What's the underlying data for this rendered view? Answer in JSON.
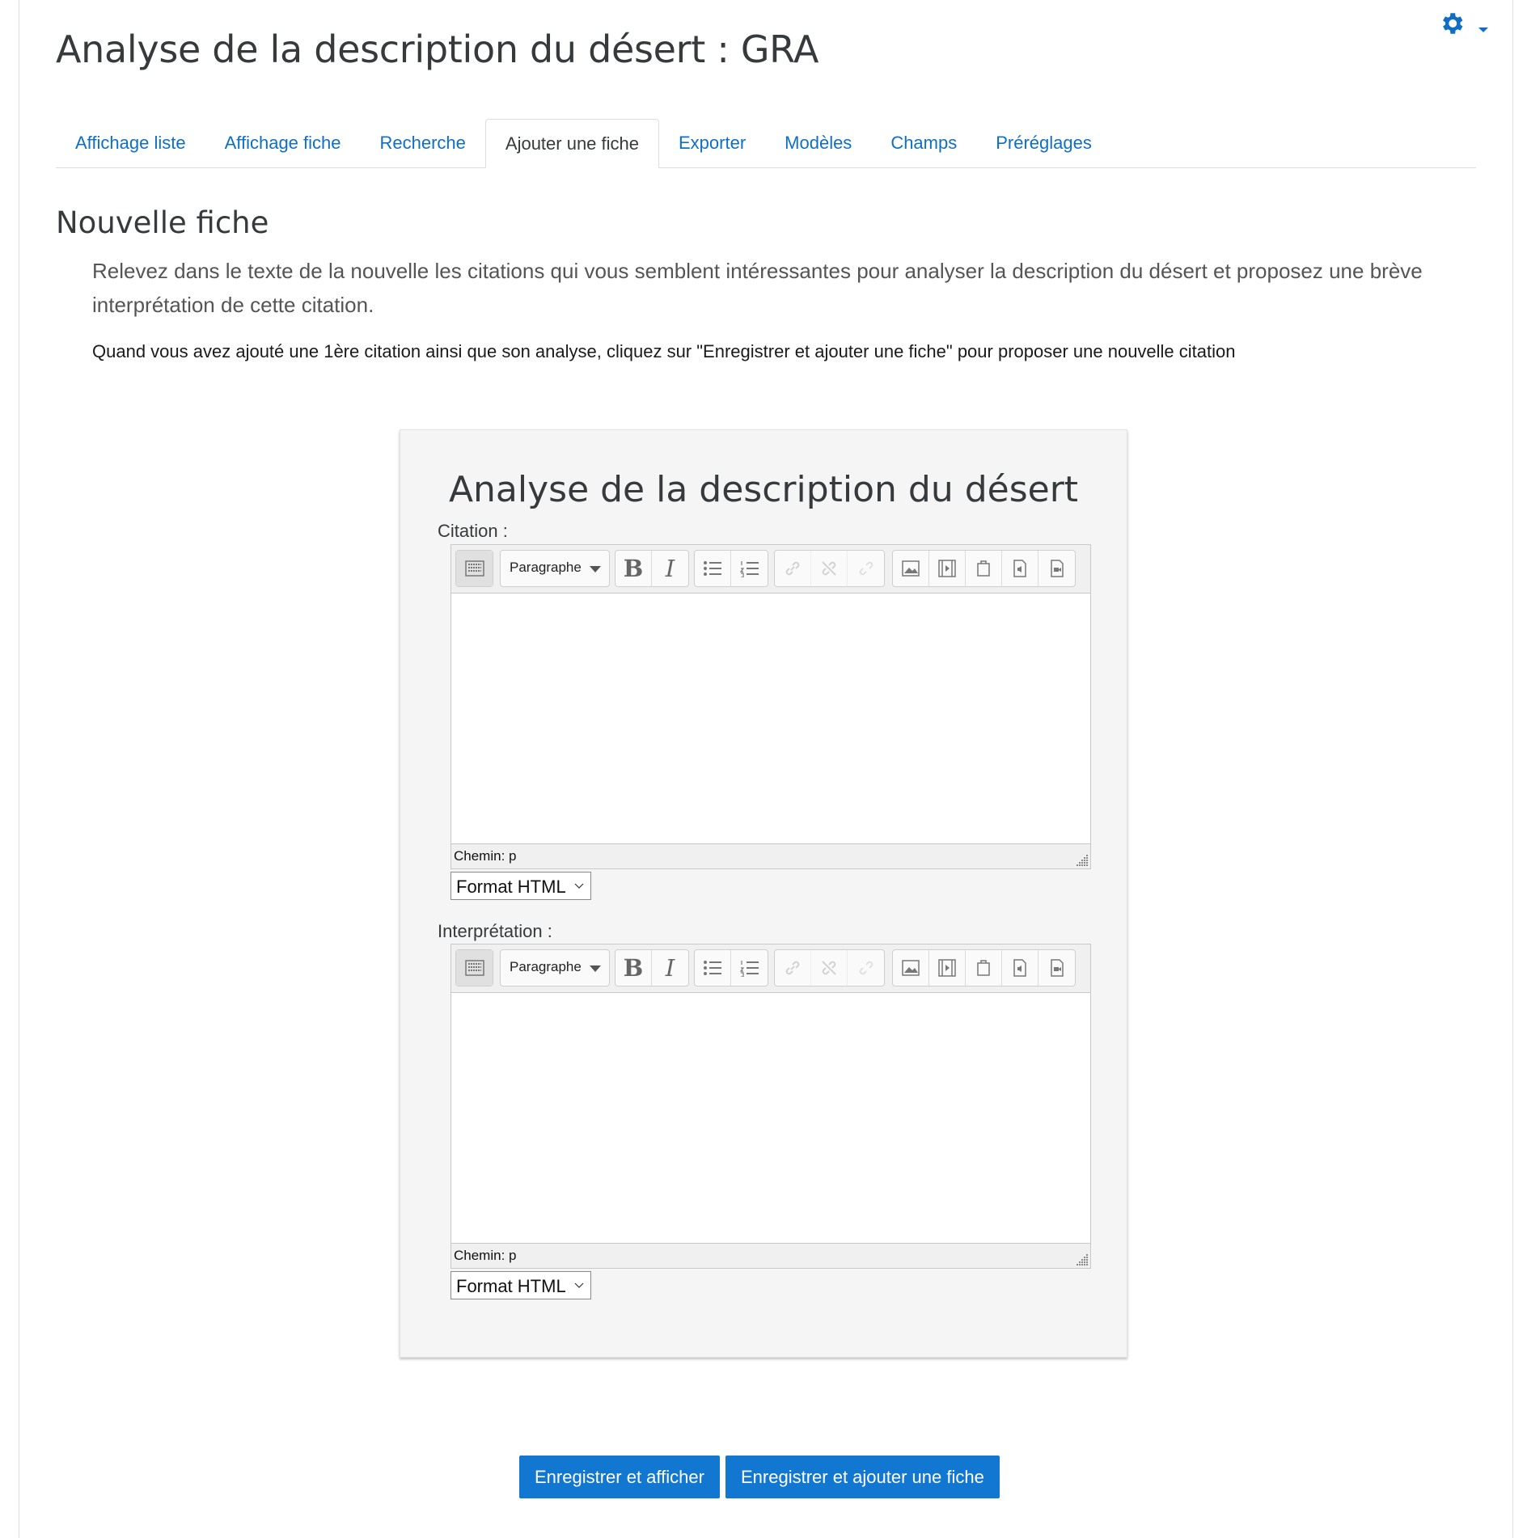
{
  "page": {
    "title": "Analyse de la description du désert : GRA"
  },
  "header": {
    "gear_icon": "gear-icon",
    "accent_color": "#0f6fc5"
  },
  "tabs": [
    {
      "label": "Affichage liste",
      "active": false
    },
    {
      "label": "Affichage fiche",
      "active": false
    },
    {
      "label": "Recherche",
      "active": false
    },
    {
      "label": "Ajouter une fiche",
      "active": true
    },
    {
      "label": "Exporter",
      "active": false
    },
    {
      "label": "Modèles",
      "active": false
    },
    {
      "label": "Champs",
      "active": false
    },
    {
      "label": "Préréglages",
      "active": false
    }
  ],
  "main": {
    "section_title": "Nouvelle fiche",
    "intro": "Relevez dans le texte de la nouvelle les citations qui vous semblent intéressantes pour analyser la description du désert et proposez une brève interprétation de cette citation.",
    "instruction": "Quand vous avez ajouté une 1ère citation ainsi que son analyse, cliquez sur \"Enregistrer et ajouter une fiche\" pour proposer une nouvelle citation"
  },
  "form": {
    "heading": "Analyse de la description du désert",
    "fields": [
      {
        "label": "Citation :",
        "block_format": "Paragraphe",
        "path": "Chemin: p",
        "text_format": "Format HTML"
      },
      {
        "label": "Interprétation :",
        "block_format": "Paragraphe",
        "path": "Chemin: p",
        "text_format": "Format HTML"
      }
    ],
    "toolbar_icons": [
      "toolbar-toggle-icon",
      "bold-icon",
      "italic-icon",
      "unordered-list-icon",
      "ordered-list-icon",
      "link-icon",
      "unlink-icon",
      "anchor-icon",
      "image-icon",
      "media-icon",
      "manage-files-icon",
      "audio-record-icon",
      "video-record-icon"
    ]
  },
  "actions": {
    "save_view": "Enregistrer et afficher",
    "save_add": "Enregistrer et ajouter une fiche",
    "button_color": "#1177d1"
  }
}
